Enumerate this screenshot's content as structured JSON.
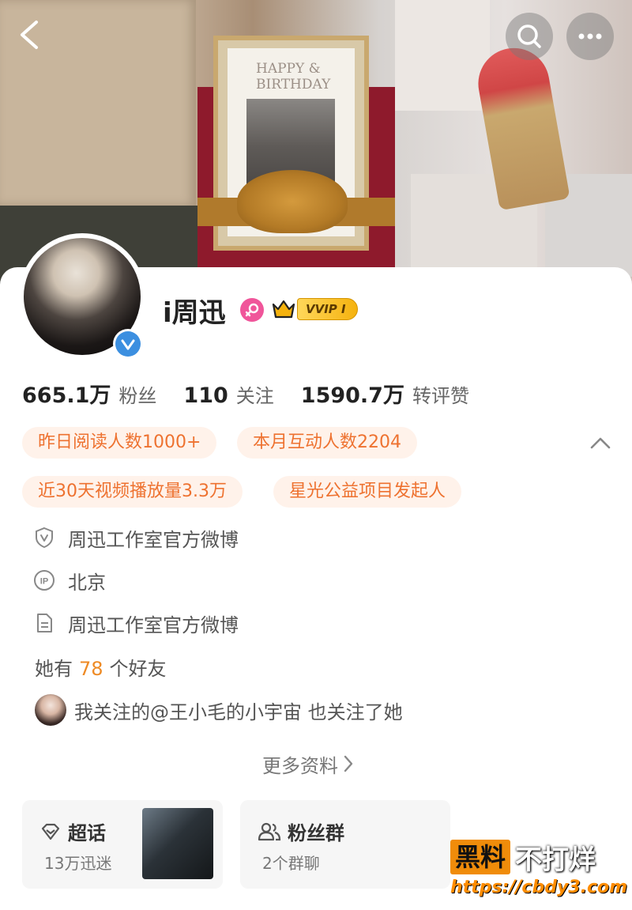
{
  "header": {
    "back_icon": "chevron-left-icon",
    "search_icon": "search-icon",
    "more_icon": "more-horizontal-icon"
  },
  "cover": {
    "card_text_line1": "HAPPY &",
    "card_text_line2": "BIRTHDAY"
  },
  "profile": {
    "username": "i周迅",
    "gender": "female",
    "vip_label": "VVIP I",
    "verified": true,
    "colors": {
      "verified_blue": "#3c8fe0",
      "gender_pink": "#f0559a",
      "tag_orange": "#ee7230",
      "tag_bg": "#fff2ea",
      "vip_gold": "#f5b20e"
    }
  },
  "stats": [
    {
      "num": "665.1万",
      "label": "粉丝"
    },
    {
      "num": "110",
      "label": "关注"
    },
    {
      "num": "1590.7万",
      "label": "转评赞"
    }
  ],
  "tags": [
    "昨日阅读人数1000+",
    "本月互动人数2204",
    "近30天视频播放量3.3万",
    "星光公益项目发起人"
  ],
  "info": [
    {
      "icon": "shield-v-icon",
      "text": "周迅工作室官方微博"
    },
    {
      "icon": "ip-icon",
      "text": "北京"
    },
    {
      "icon": "document-icon",
      "text": "周迅工作室官方微博"
    }
  ],
  "friends": {
    "prefix": "她有",
    "count": "78",
    "suffix": "个好友"
  },
  "mutual": {
    "text": "我关注的@王小毛的小宇宙 也关注了她"
  },
  "more_info": {
    "label": "更多资料"
  },
  "cards": [
    {
      "title": "超话",
      "sub": "13万迅迷",
      "icon": "diamond-icon"
    },
    {
      "title": "粉丝群",
      "sub": "2个群聊",
      "icon": "group-icon"
    }
  ],
  "watermark": {
    "box": "黑料",
    "text": "不打烊",
    "url": "https://cbdy3.com"
  }
}
